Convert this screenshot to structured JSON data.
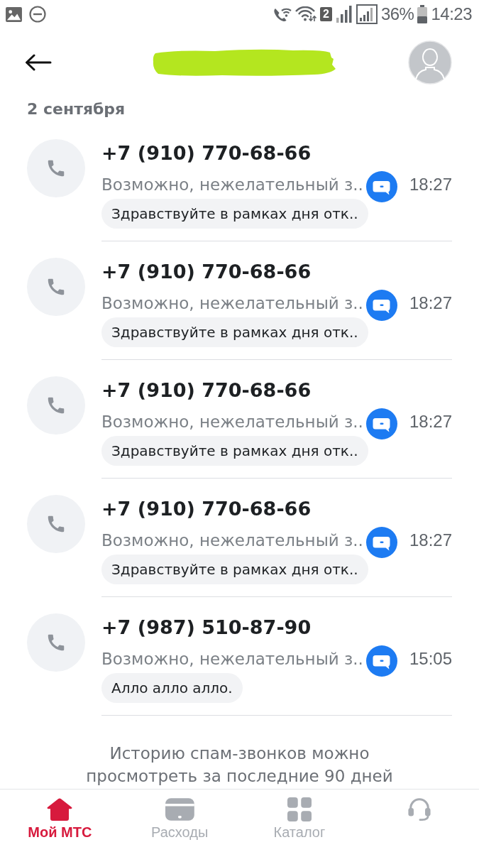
{
  "status_bar": {
    "sim_badge": "2",
    "battery_percent": "36%",
    "time": "14:23"
  },
  "header": {
    "title_redacted": true
  },
  "date": "2 сентября",
  "calls": [
    {
      "number": "+7 (910) 770-68-66",
      "label": "Возможно, нежелательный з..",
      "time": "18:27",
      "message": "Здравствуйте в рамках дня отк.."
    },
    {
      "number": "+7 (910) 770-68-66",
      "label": "Возможно, нежелательный з..",
      "time": "18:27",
      "message": "Здравствуйте в рамках дня отк.."
    },
    {
      "number": "+7 (910) 770-68-66",
      "label": "Возможно, нежелательный з..",
      "time": "18:27",
      "message": "Здравствуйте в рамках дня отк.."
    },
    {
      "number": "+7 (910) 770-68-66",
      "label": "Возможно, нежелательный з..",
      "time": "18:27",
      "message": "Здравствуйте в рамках дня отк.."
    },
    {
      "number": "+7 (987) 510-87-90",
      "label": "Возможно, нежелательный з..",
      "time": "15:05",
      "message": "Алло алло алло."
    }
  ],
  "footer_note": "Историю спам-звонков можно просмотреть за последние 90 дней",
  "bottom_nav": [
    {
      "label": "Мой МТС",
      "selected": true
    },
    {
      "label": "Расходы",
      "selected": false
    },
    {
      "label": "Каталог",
      "selected": false
    },
    {
      "selected": false
    }
  ]
}
